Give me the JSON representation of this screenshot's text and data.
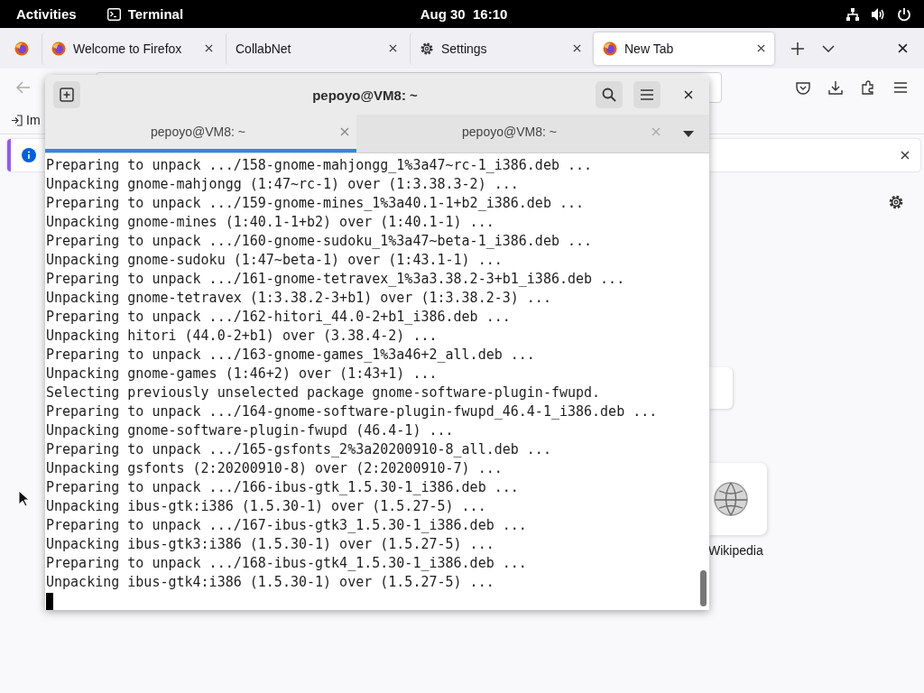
{
  "top_bar": {
    "activities": "Activities",
    "app_name": "Terminal",
    "clock": "Aug 30  16:10"
  },
  "browser": {
    "tabs": [
      {
        "label": "Welcome to Firefox",
        "kind": "web",
        "selected": false
      },
      {
        "label": "CollabNet",
        "kind": "blank",
        "selected": false
      },
      {
        "label": "Settings",
        "kind": "settings",
        "selected": false
      },
      {
        "label": "New Tab",
        "kind": "web",
        "selected": true
      }
    ],
    "bookmarks": [
      "Im"
    ],
    "shortcuts": [
      {
        "label": "Wikipedia"
      }
    ]
  },
  "terminal": {
    "title": "pepoyo@VM8: ~",
    "tabs": [
      {
        "label": "pepoyo@VM8: ~",
        "selected": true
      },
      {
        "label": "pepoyo@VM8: ~",
        "selected": false
      }
    ],
    "lines": [
      "Preparing to unpack .../158-gnome-mahjongg_1%3a47~rc-1_i386.deb ...",
      "Unpacking gnome-mahjongg (1:47~rc-1) over (1:3.38.3-2) ...",
      "Preparing to unpack .../159-gnome-mines_1%3a40.1-1+b2_i386.deb ...",
      "Unpacking gnome-mines (1:40.1-1+b2) over (1:40.1-1) ...",
      "Preparing to unpack .../160-gnome-sudoku_1%3a47~beta-1_i386.deb ...",
      "Unpacking gnome-sudoku (1:47~beta-1) over (1:43.1-1) ...",
      "Preparing to unpack .../161-gnome-tetravex_1%3a3.38.2-3+b1_i386.deb ...",
      "Unpacking gnome-tetravex (1:3.38.2-3+b1) over (1:3.38.2-3) ...",
      "Preparing to unpack .../162-hitori_44.0-2+b1_i386.deb ...",
      "Unpacking hitori (44.0-2+b1) over (3.38.4-2) ...",
      "Preparing to unpack .../163-gnome-games_1%3a46+2_all.deb ...",
      "Unpacking gnome-games (1:46+2) over (1:43+1) ...",
      "Selecting previously unselected package gnome-software-plugin-fwupd.",
      "Preparing to unpack .../164-gnome-software-plugin-fwupd_46.4-1_i386.deb ...",
      "Unpacking gnome-software-plugin-fwupd (46.4-1) ...",
      "Preparing to unpack .../165-gsfonts_2%3a20200910-8_all.deb ...",
      "Unpacking gsfonts (2:20200910-8) over (2:20200910-7) ...",
      "Preparing to unpack .../166-ibus-gtk_1.5.30-1_i386.deb ...",
      "Unpacking ibus-gtk:i386 (1.5.30-1) over (1.5.27-5) ...",
      "Preparing to unpack .../167-ibus-gtk3_1.5.30-1_i386.deb ...",
      "Unpacking ibus-gtk3:i386 (1.5.30-1) over (1.5.27-5) ...",
      "Preparing to unpack .../168-ibus-gtk4_1.5.30-1_i386.deb ...",
      "Unpacking ibus-gtk4:i386 (1.5.30-1) over (1.5.27-5) ..."
    ]
  }
}
